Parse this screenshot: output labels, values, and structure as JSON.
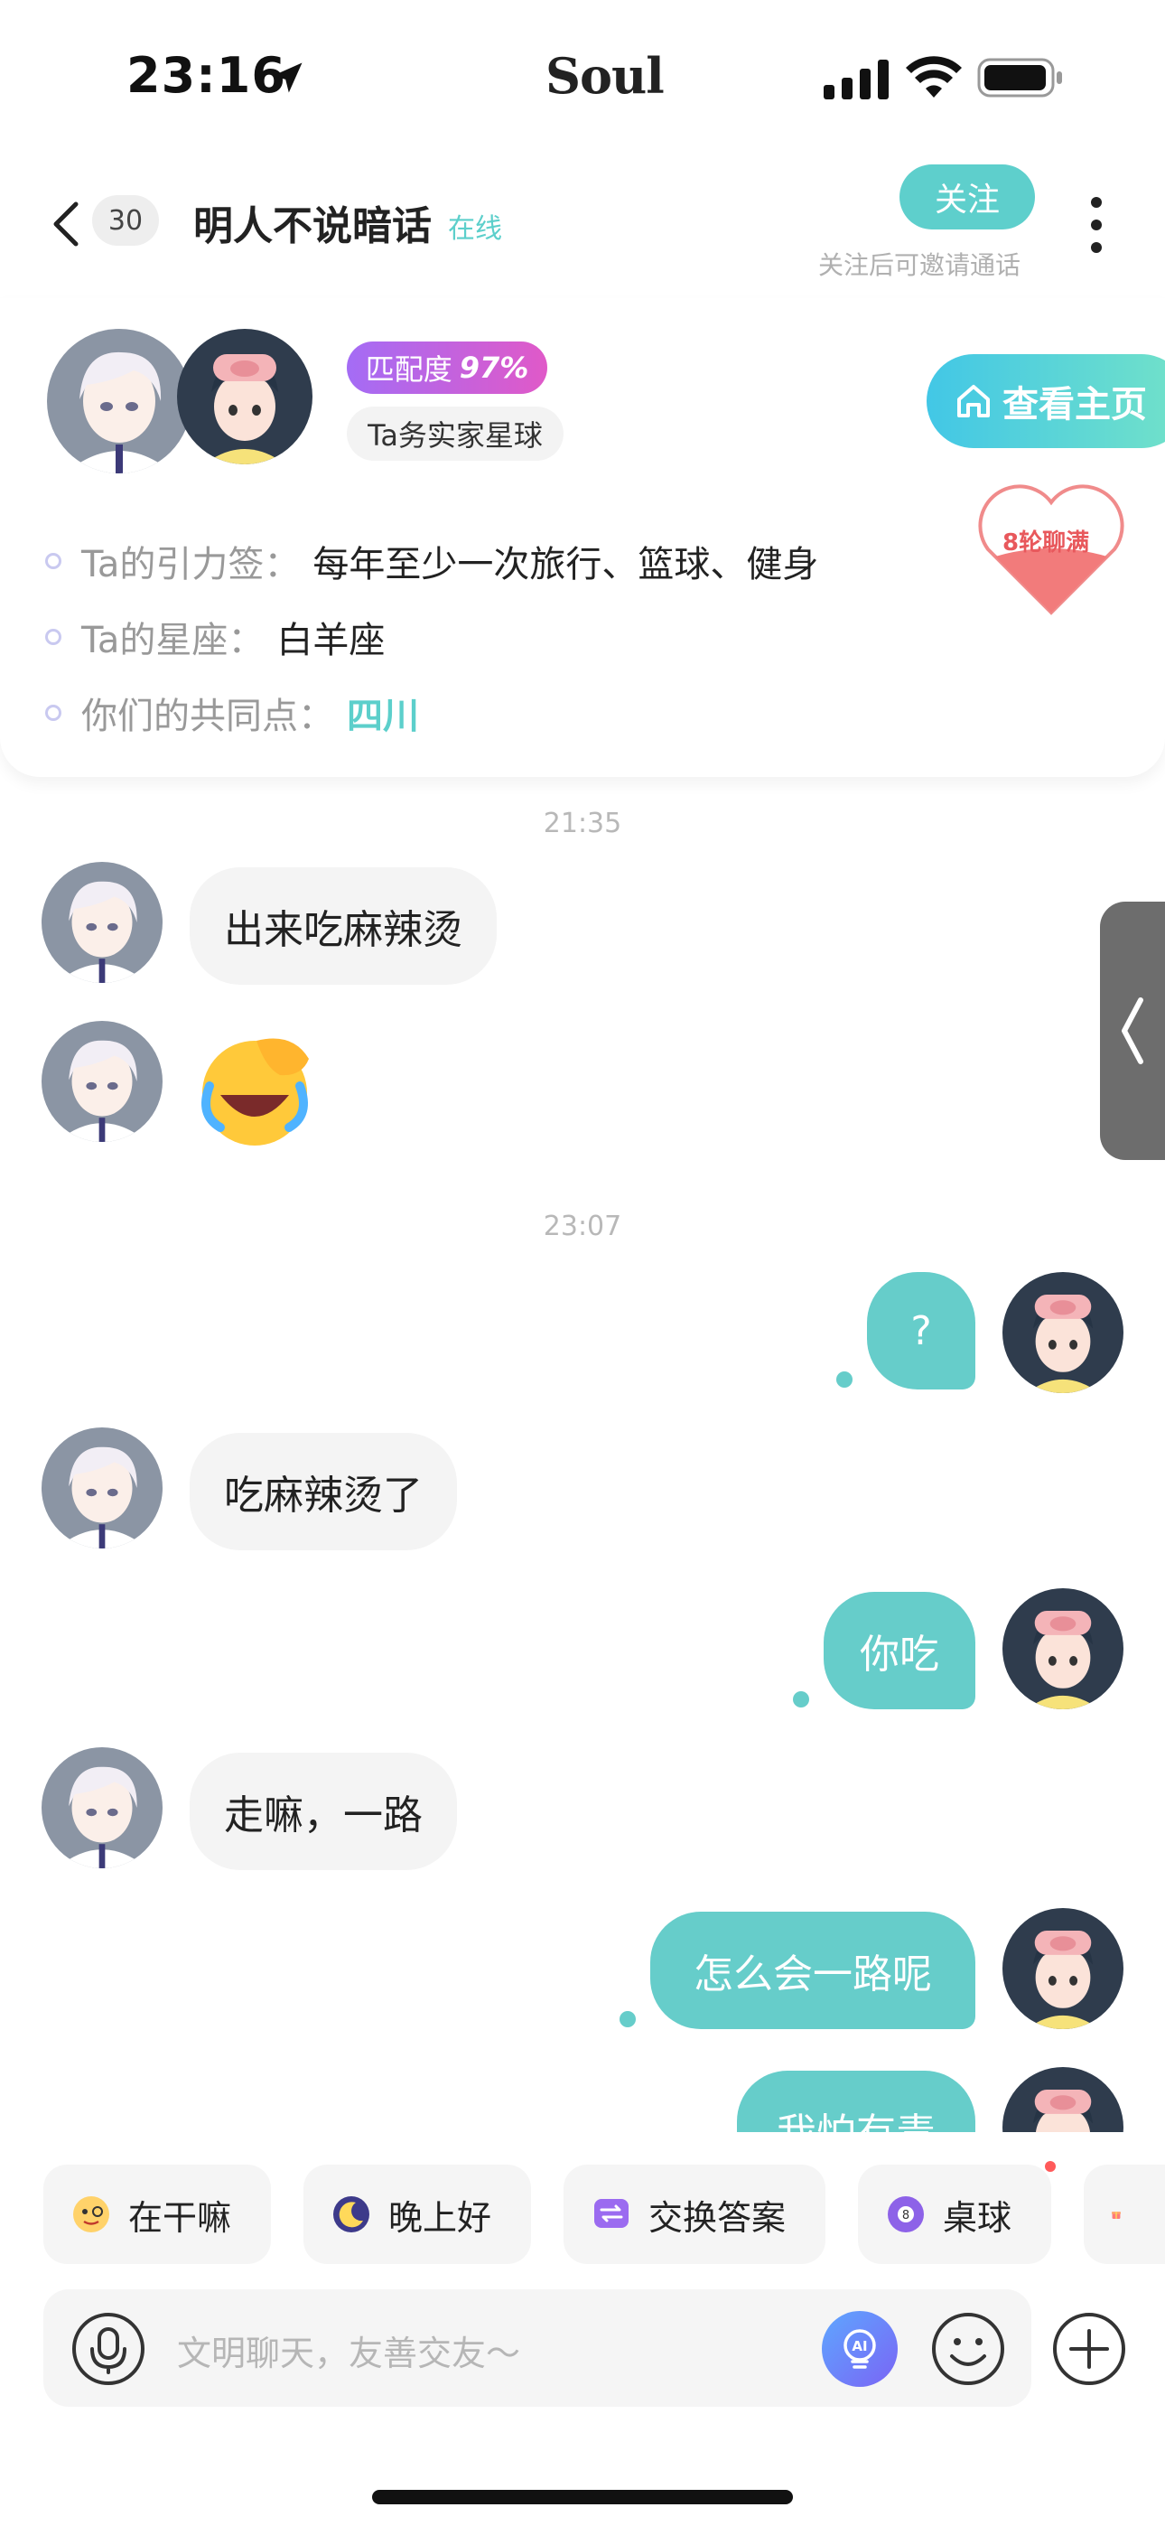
{
  "status_bar": {
    "time": "23:16",
    "brand": "Soul"
  },
  "header": {
    "unread_count": "30",
    "chat_name": "明人不说暗话",
    "online_status": "在线",
    "follow_label": "关注",
    "follow_hint": "关注后可邀请通话"
  },
  "profile": {
    "match_label": "匹配度",
    "match_value": "97%",
    "planet_tag": "Ta务实家星球",
    "view_profile_label": "查看主页",
    "chat_rounds_label": "8轮聊满",
    "gravity_label": "Ta的引力签：",
    "gravity_value": "每年至少一次旅行、篮球、健身",
    "zodiac_label": "Ta的星座：",
    "zodiac_value": "白羊座",
    "common_label": "你们的共同点：",
    "common_value": "四川"
  },
  "messages": {
    "timestamp_1": "21:35",
    "timestamp_2": "23:07",
    "m1": "出来吃麻辣烫",
    "m3": "?",
    "m4": "吃麻辣烫了",
    "m5": "你吃",
    "m6": "走嘛，一路",
    "m7": "怎么会一路呢",
    "m8": "我怕有毒"
  },
  "quick_replies": [
    {
      "label": "在干嘛",
      "icon": "face-emoji-icon"
    },
    {
      "label": "晚上好",
      "icon": "moon-icon"
    },
    {
      "label": "交换答案",
      "icon": "swap-icon"
    },
    {
      "label": "桌球",
      "icon": "billiard-ball-icon"
    }
  ],
  "input": {
    "placeholder": "文明聊天，友善交友～"
  },
  "colors": {
    "accent": "#5ecfcc",
    "bubble_out": "#66cdca",
    "bubble_in": "#f4f4f4"
  }
}
